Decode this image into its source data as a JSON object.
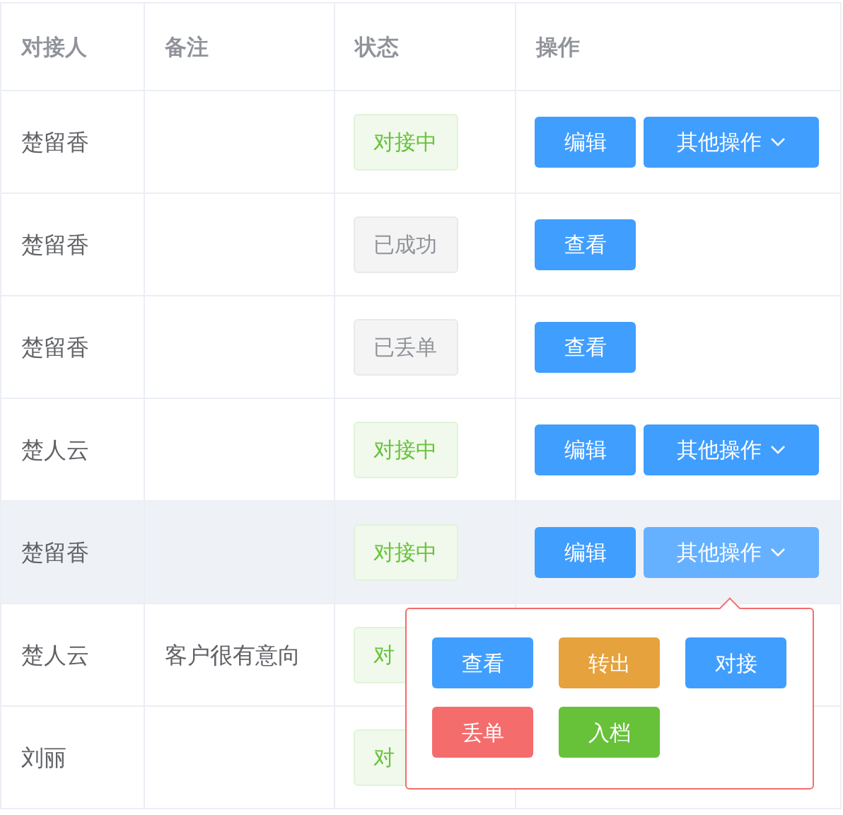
{
  "table": {
    "columns": [
      "对接人",
      "备注",
      "状态",
      "操作"
    ],
    "rows": [
      {
        "contact": "楚留香",
        "status": {
          "text": "对接中",
          "kind": "processing"
        },
        "actions": [
          {
            "label": "编辑",
            "kind": "primary"
          },
          {
            "label": "其他操作",
            "kind": "dropdown",
            "active": false
          }
        ],
        "hovered": false
      },
      {
        "contact": "楚留香",
        "status": {
          "text": "已成功",
          "kind": "closed"
        },
        "actions": [
          {
            "label": "查看",
            "kind": "primary"
          }
        ],
        "hovered": false
      },
      {
        "contact": "楚留香",
        "status": {
          "text": "已丢单",
          "kind": "closed"
        },
        "actions": [
          {
            "label": "查看",
            "kind": "primary"
          }
        ],
        "hovered": false
      },
      {
        "contact": "楚人云",
        "status": {
          "text": "对接中",
          "kind": "processing"
        },
        "actions": [
          {
            "label": "编辑",
            "kind": "primary"
          },
          {
            "label": "其他操作",
            "kind": "dropdown",
            "active": false
          }
        ],
        "hovered": false
      },
      {
        "contact": "楚留香",
        "status": {
          "text": "对接中",
          "kind": "processing"
        },
        "actions": [
          {
            "label": "编辑",
            "kind": "primary"
          },
          {
            "label": "其他操作",
            "kind": "dropdown",
            "active": true
          }
        ],
        "hovered": true
      },
      {
        "contact": "楚人云",
        "note": "客户很有意向",
        "status": {
          "text": "对",
          "kind": "processing"
        },
        "hovered": false
      },
      {
        "contact": "刘丽",
        "status": {
          "text": "对",
          "kind": "processing"
        },
        "hovered": false
      }
    ]
  },
  "popover": {
    "buttons": [
      {
        "label": "查看",
        "kind": "primary"
      },
      {
        "label": "转出",
        "kind": "warning"
      },
      {
        "label": "对接",
        "kind": "primary"
      },
      {
        "label": "丢单",
        "kind": "danger"
      },
      {
        "label": "入档",
        "kind": "success"
      }
    ]
  }
}
